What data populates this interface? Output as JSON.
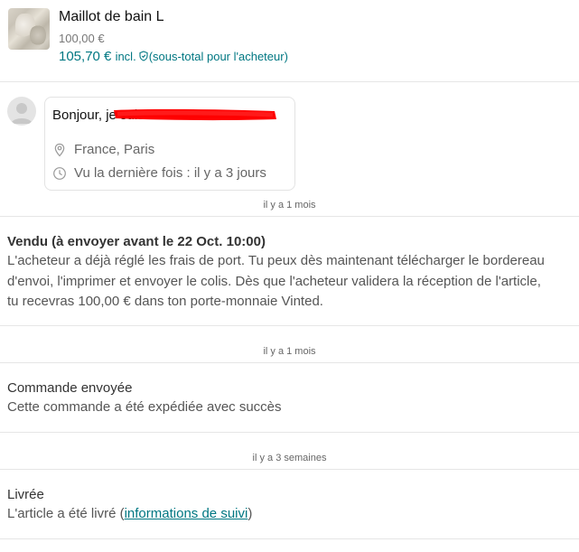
{
  "item": {
    "title": "Maillot de bain L",
    "price": "100,00 €",
    "total": "105,70 €",
    "total_incl": "incl.",
    "total_note": "(sous-total pour l'acheteur)"
  },
  "message": {
    "greeting": "Bonjour, je suis",
    "location": "France, Paris",
    "last_seen": "Vu la dernière fois : il y a 3 jours",
    "time": "il y a 1 mois"
  },
  "events": {
    "sold": {
      "title": "Vendu (à envoyer avant le 22 Oct. 10:00)",
      "body": "L'acheteur a déjà réglé les frais de port. Tu peux dès maintenant télécharger le bordereau d'envoi, l'imprimer et envoyer le colis. Dès que l'acheteur validera la réception de l'article, tu recevras 100,00 € dans ton porte-monnaie Vinted."
    },
    "shipped": {
      "time": "il y a 1 mois",
      "title": "Commande envoyée",
      "body": "Cette commande a été expédiée avec succès"
    },
    "delivered": {
      "time": "il y a 3 semaines",
      "title": "Livrée",
      "body_prefix": "L'article a été livré (",
      "link": "informations de suivi",
      "body_suffix": ")"
    }
  },
  "colors": {
    "accent": "#007782",
    "redaction": "#ff0000"
  }
}
